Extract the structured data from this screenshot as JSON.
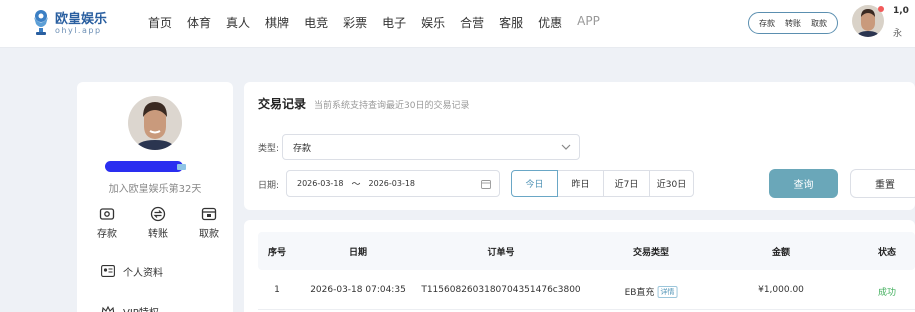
{
  "header": {
    "logo": {
      "name": "欧皇娱乐",
      "sub": "ohyl.app"
    },
    "nav": [
      "首页",
      "体育",
      "真人",
      "棋牌",
      "电竞",
      "彩票",
      "电子",
      "娱乐",
      "合营",
      "客服",
      "优惠",
      "APP"
    ],
    "quick_actions": [
      "存款",
      "转账",
      "取款"
    ],
    "balance_partial": "1,0",
    "label_partial": "永"
  },
  "sidebar": {
    "days_text": "加入欧皇娱乐第32天",
    "actions": [
      {
        "label": "存款",
        "icon": "deposit-icon"
      },
      {
        "label": "转账",
        "icon": "transfer-icon"
      },
      {
        "label": "取款",
        "icon": "withdraw-icon"
      }
    ],
    "menu": [
      {
        "label": "个人资料",
        "icon": "id-card-icon"
      },
      {
        "label": "VIP特权",
        "icon": "crown-icon"
      }
    ]
  },
  "filter": {
    "title": "交易记录",
    "subtitle": "当前系统支持查询最近30日的交易记录",
    "type_label": "类型:",
    "type_value": "存款",
    "date_label": "日期:",
    "date_start": "2026-03-18",
    "date_sep": "～",
    "date_end": "2026-03-18",
    "quick_ranges": [
      "今日",
      "昨日",
      "近7日",
      "近30日"
    ],
    "active_range": "今日",
    "query_label": "查询",
    "reset_label": "重置"
  },
  "table": {
    "columns": [
      "序号",
      "日期",
      "订单号",
      "交易类型",
      "金额",
      "状态"
    ],
    "rows": [
      {
        "index": "1",
        "date": "2026-03-18 07:04:35",
        "order_no": "T1156082603180704351476c3800",
        "type": "EB直充",
        "type_tag": "详情",
        "amount": "¥1,000.00",
        "status": "成功"
      }
    ]
  },
  "colors": {
    "accent": "#6aa7b9",
    "brand": "#2a5fa0",
    "success": "#3fae5b",
    "page_bg": "#eef1f6"
  }
}
